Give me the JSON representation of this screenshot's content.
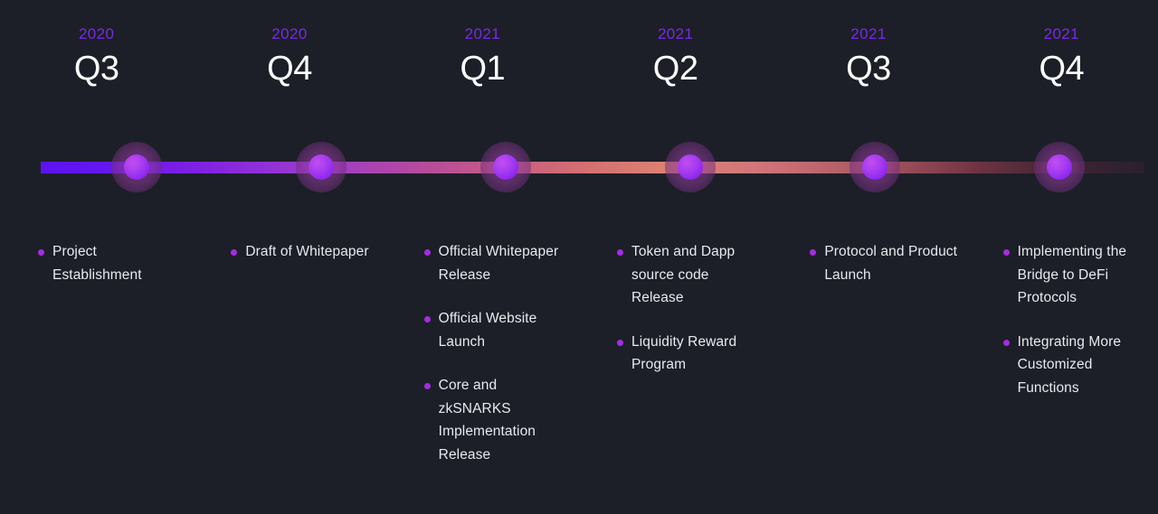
{
  "theme": {
    "background": "#1c1f27",
    "year_color": "#7b28e8",
    "quarter_color": "#ffffff",
    "text_color": "#e9e9ef",
    "bullet_color": "#a22ee0",
    "node_core_color": "#a93df0",
    "node_halo_color": "#963ea0",
    "track_gradient_start": "#5b13ef",
    "track_gradient_mid": "#d47271",
    "track_gradient_end": "#2a2030"
  },
  "timeline": {
    "columns": [
      {
        "year": "2020",
        "quarter": "Q3",
        "milestones": [
          "Project Establishment"
        ]
      },
      {
        "year": "2020",
        "quarter": "Q4",
        "milestones": [
          "Draft of Whitepaper"
        ]
      },
      {
        "year": "2021",
        "quarter": "Q1",
        "milestones": [
          "Official Whitepaper Release",
          "Official Website Launch",
          "Core and zkSNARKS Implementation Release"
        ]
      },
      {
        "year": "2021",
        "quarter": "Q2",
        "milestones": [
          "Token and Dapp source code Release",
          "Liquidity Reward Program"
        ]
      },
      {
        "year": "2021",
        "quarter": "Q3",
        "milestones": [
          "Protocol and Product Launch"
        ]
      },
      {
        "year": "2021",
        "quarter": "Q4",
        "milestones": [
          "Implementing the Bridge to DeFi Protocols",
          "Integrating More Customized Functions"
        ]
      }
    ]
  }
}
